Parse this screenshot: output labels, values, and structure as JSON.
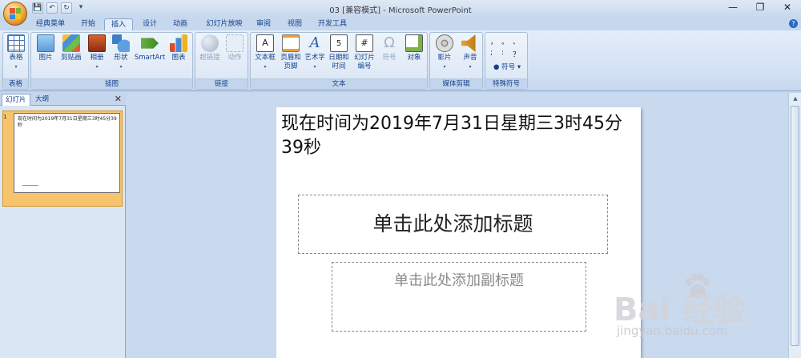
{
  "window": {
    "title": "03 [兼容模式] - Microsoft PowerPoint",
    "minimize": "—",
    "restore": "❐",
    "close": "✕"
  },
  "qat": {
    "save": "💾",
    "undo": "↶",
    "redo": "↻",
    "customize": "▾"
  },
  "tabs": [
    {
      "label": "经典菜单",
      "active": false
    },
    {
      "label": "开始",
      "active": false
    },
    {
      "label": "插入",
      "active": true
    },
    {
      "label": "设计",
      "active": false
    },
    {
      "label": "动画",
      "active": false
    },
    {
      "label": "幻灯片放映",
      "active": false
    },
    {
      "label": "审阅",
      "active": false
    },
    {
      "label": "视图",
      "active": false
    },
    {
      "label": "开发工具",
      "active": false
    }
  ],
  "help": "?",
  "ribbon": {
    "groups": {
      "table": "表格",
      "illustrations": "插图",
      "links": "链接",
      "text": "文本",
      "media": "媒体剪辑",
      "special": "特殊符号"
    },
    "buttons": {
      "table": "表格",
      "picture": "图片",
      "clipart": "剪贴画",
      "album": "相册",
      "shapes": "形状",
      "smartart": "SmartArt",
      "chart": "图表",
      "hyperlink": "超链接",
      "action": "动作",
      "textbox": "文本框",
      "header_footer_1": "页眉和",
      "header_footer_2": "页脚",
      "wordart": "艺术字",
      "datetime_1": "日期和",
      "datetime_2": "时间",
      "slide_number_1": "幻灯片",
      "slide_number_2": "编号",
      "symbol": "符号",
      "object": "对象",
      "movie": "影片",
      "sound": "声音",
      "symbol_menu": "符号"
    },
    "special_chars": [
      "，",
      "。",
      "、",
      ";",
      ":",
      "？"
    ]
  },
  "panel": {
    "tab_slides": "幻灯片",
    "tab_outline": "大纲",
    "close": "✕",
    "slide_number": "1",
    "thumb_text": "现在时间为2019年7月31日星期三3时45分39秒"
  },
  "slide": {
    "body_text": "现在时间为2019年7月31日星期三3时45分39秒",
    "title_placeholder": "单击此处添加标题",
    "subtitle_placeholder": "单击此处添加副标题"
  },
  "watermark": {
    "brand": "Bai  经验",
    "url": "jingyan.baidu.com"
  },
  "colors": {
    "accent": "#15428b",
    "selected_thumb": "#f7c46d",
    "ribbon_bg": "#dbe6f4"
  }
}
